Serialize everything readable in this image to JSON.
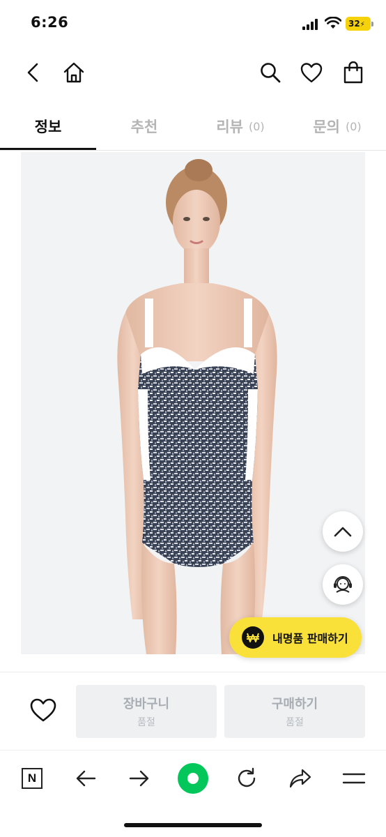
{
  "status_bar": {
    "time": "6:26",
    "battery": "32"
  },
  "header": {
    "icons": [
      "back-icon",
      "home-icon",
      "search-icon",
      "heart-icon",
      "shopping-bag-icon"
    ]
  },
  "tabs": [
    {
      "label": "정보",
      "count": "",
      "active": true
    },
    {
      "label": "추천",
      "count": "",
      "active": false
    },
    {
      "label": "리뷰",
      "count": "(0)",
      "active": false
    },
    {
      "label": "문의",
      "count": "(0)",
      "active": false
    }
  ],
  "floating": {
    "sell_label": "내명품 판매하기",
    "icons": [
      "chevron-up-icon",
      "headset-support-icon",
      "won-icon"
    ]
  },
  "purchase_bar": {
    "cart": {
      "label": "장바구니",
      "status": "품절"
    },
    "buy": {
      "label": "구매하기",
      "status": "품절"
    }
  },
  "browser_bar": {
    "icons": [
      "naver-n-icon",
      "back-arrow-icon",
      "forward-arrow-icon",
      "green-circle-icon",
      "refresh-icon",
      "share-icon",
      "menu-icon"
    ],
    "n_letter": "N"
  },
  "colors": {
    "accent_yellow": "#f9e13a",
    "naver_green": "#03c75a",
    "active_tab": "#111111",
    "inactive_tab": "#b4b4b4"
  }
}
